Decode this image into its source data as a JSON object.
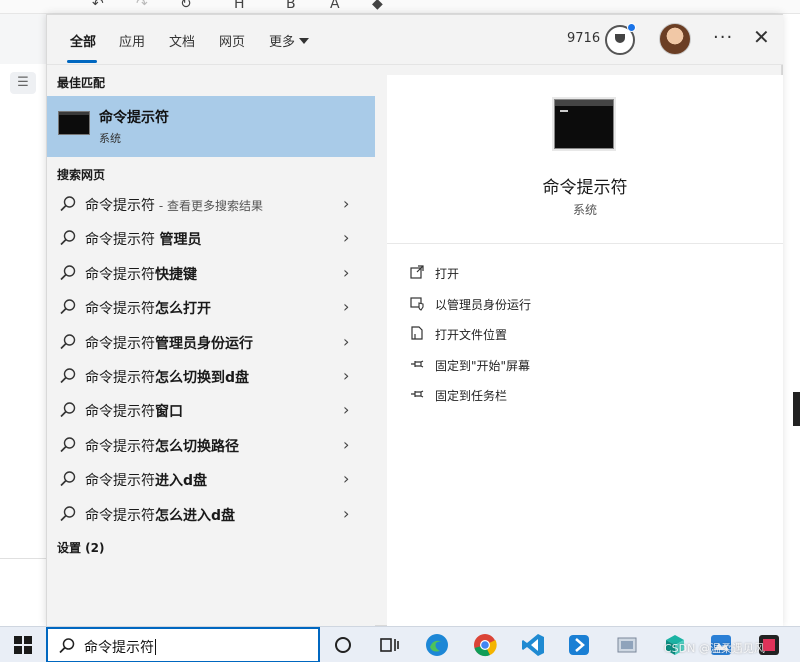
{
  "header": {
    "tabs": [
      {
        "label": "全部",
        "active": true
      },
      {
        "label": "应用"
      },
      {
        "label": "文档"
      },
      {
        "label": "网页"
      },
      {
        "label": "更多"
      }
    ],
    "points": "9716",
    "more_icon": "ellipsis-icon",
    "close_icon": "close-icon"
  },
  "best_match": {
    "section_title": "最佳匹配",
    "title": "命令提示符",
    "subtitle": "系统"
  },
  "web_search": {
    "section_title": "搜索网页",
    "items": [
      {
        "prefix": "命令提示符",
        "bold": "",
        "hint": " - 查看更多搜索结果"
      },
      {
        "prefix": "命令提示符 ",
        "bold": "管理员",
        "hint": ""
      },
      {
        "prefix": "命令提示符",
        "bold": "快捷键",
        "hint": ""
      },
      {
        "prefix": "命令提示符",
        "bold": "怎么打开",
        "hint": ""
      },
      {
        "prefix": "命令提示符",
        "bold": "管理员身份运行",
        "hint": ""
      },
      {
        "prefix": "命令提示符",
        "bold": "怎么切换到d盘",
        "hint": ""
      },
      {
        "prefix": "命令提示符",
        "bold": "窗口",
        "hint": ""
      },
      {
        "prefix": "命令提示符",
        "bold": "怎么切换路径",
        "hint": ""
      },
      {
        "prefix": "命令提示符",
        "bold": "进入d盘",
        "hint": ""
      },
      {
        "prefix": "命令提示符",
        "bold": "怎么进入d盘",
        "hint": ""
      }
    ]
  },
  "settings": {
    "section_title": "设置 (2)"
  },
  "preview": {
    "title": "命令提示符",
    "subtitle": "系统",
    "actions": [
      {
        "label": "打开",
        "icon": "open-icon"
      },
      {
        "label": "以管理员身份运行",
        "icon": "run-as-admin-icon"
      },
      {
        "label": "打开文件位置",
        "icon": "file-location-icon"
      },
      {
        "label": "固定到\"开始\"屏幕",
        "icon": "pin-icon"
      },
      {
        "label": "固定到任务栏",
        "icon": "pin-icon"
      }
    ]
  },
  "taskbar": {
    "search_value": "命令提示符",
    "apps": [
      "cortana-icon",
      "task-view-icon",
      "edge-icon",
      "chrome-icon",
      "vscode-icon",
      "app-icon",
      "folder-icon",
      "app-icon",
      "app-icon",
      "app-icon"
    ]
  },
  "watermark": "CSDN @温柔遇见风",
  "colors": {
    "accent": "#0067c0",
    "selected_row": "#a9cbe8"
  }
}
